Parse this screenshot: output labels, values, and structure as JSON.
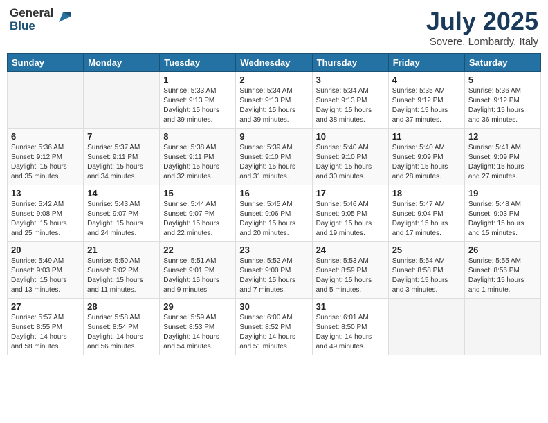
{
  "logo": {
    "general": "General",
    "blue": "Blue"
  },
  "header": {
    "month": "July 2025",
    "location": "Sovere, Lombardy, Italy"
  },
  "weekdays": [
    "Sunday",
    "Monday",
    "Tuesday",
    "Wednesday",
    "Thursday",
    "Friday",
    "Saturday"
  ],
  "weeks": [
    [
      {
        "day": "",
        "info": ""
      },
      {
        "day": "",
        "info": ""
      },
      {
        "day": "1",
        "info": "Sunrise: 5:33 AM\nSunset: 9:13 PM\nDaylight: 15 hours\nand 39 minutes."
      },
      {
        "day": "2",
        "info": "Sunrise: 5:34 AM\nSunset: 9:13 PM\nDaylight: 15 hours\nand 39 minutes."
      },
      {
        "day": "3",
        "info": "Sunrise: 5:34 AM\nSunset: 9:13 PM\nDaylight: 15 hours\nand 38 minutes."
      },
      {
        "day": "4",
        "info": "Sunrise: 5:35 AM\nSunset: 9:12 PM\nDaylight: 15 hours\nand 37 minutes."
      },
      {
        "day": "5",
        "info": "Sunrise: 5:36 AM\nSunset: 9:12 PM\nDaylight: 15 hours\nand 36 minutes."
      }
    ],
    [
      {
        "day": "6",
        "info": "Sunrise: 5:36 AM\nSunset: 9:12 PM\nDaylight: 15 hours\nand 35 minutes."
      },
      {
        "day": "7",
        "info": "Sunrise: 5:37 AM\nSunset: 9:11 PM\nDaylight: 15 hours\nand 34 minutes."
      },
      {
        "day": "8",
        "info": "Sunrise: 5:38 AM\nSunset: 9:11 PM\nDaylight: 15 hours\nand 32 minutes."
      },
      {
        "day": "9",
        "info": "Sunrise: 5:39 AM\nSunset: 9:10 PM\nDaylight: 15 hours\nand 31 minutes."
      },
      {
        "day": "10",
        "info": "Sunrise: 5:40 AM\nSunset: 9:10 PM\nDaylight: 15 hours\nand 30 minutes."
      },
      {
        "day": "11",
        "info": "Sunrise: 5:40 AM\nSunset: 9:09 PM\nDaylight: 15 hours\nand 28 minutes."
      },
      {
        "day": "12",
        "info": "Sunrise: 5:41 AM\nSunset: 9:09 PM\nDaylight: 15 hours\nand 27 minutes."
      }
    ],
    [
      {
        "day": "13",
        "info": "Sunrise: 5:42 AM\nSunset: 9:08 PM\nDaylight: 15 hours\nand 25 minutes."
      },
      {
        "day": "14",
        "info": "Sunrise: 5:43 AM\nSunset: 9:07 PM\nDaylight: 15 hours\nand 24 minutes."
      },
      {
        "day": "15",
        "info": "Sunrise: 5:44 AM\nSunset: 9:07 PM\nDaylight: 15 hours\nand 22 minutes."
      },
      {
        "day": "16",
        "info": "Sunrise: 5:45 AM\nSunset: 9:06 PM\nDaylight: 15 hours\nand 20 minutes."
      },
      {
        "day": "17",
        "info": "Sunrise: 5:46 AM\nSunset: 9:05 PM\nDaylight: 15 hours\nand 19 minutes."
      },
      {
        "day": "18",
        "info": "Sunrise: 5:47 AM\nSunset: 9:04 PM\nDaylight: 15 hours\nand 17 minutes."
      },
      {
        "day": "19",
        "info": "Sunrise: 5:48 AM\nSunset: 9:03 PM\nDaylight: 15 hours\nand 15 minutes."
      }
    ],
    [
      {
        "day": "20",
        "info": "Sunrise: 5:49 AM\nSunset: 9:03 PM\nDaylight: 15 hours\nand 13 minutes."
      },
      {
        "day": "21",
        "info": "Sunrise: 5:50 AM\nSunset: 9:02 PM\nDaylight: 15 hours\nand 11 minutes."
      },
      {
        "day": "22",
        "info": "Sunrise: 5:51 AM\nSunset: 9:01 PM\nDaylight: 15 hours\nand 9 minutes."
      },
      {
        "day": "23",
        "info": "Sunrise: 5:52 AM\nSunset: 9:00 PM\nDaylight: 15 hours\nand 7 minutes."
      },
      {
        "day": "24",
        "info": "Sunrise: 5:53 AM\nSunset: 8:59 PM\nDaylight: 15 hours\nand 5 minutes."
      },
      {
        "day": "25",
        "info": "Sunrise: 5:54 AM\nSunset: 8:58 PM\nDaylight: 15 hours\nand 3 minutes."
      },
      {
        "day": "26",
        "info": "Sunrise: 5:55 AM\nSunset: 8:56 PM\nDaylight: 15 hours\nand 1 minute."
      }
    ],
    [
      {
        "day": "27",
        "info": "Sunrise: 5:57 AM\nSunset: 8:55 PM\nDaylight: 14 hours\nand 58 minutes."
      },
      {
        "day": "28",
        "info": "Sunrise: 5:58 AM\nSunset: 8:54 PM\nDaylight: 14 hours\nand 56 minutes."
      },
      {
        "day": "29",
        "info": "Sunrise: 5:59 AM\nSunset: 8:53 PM\nDaylight: 14 hours\nand 54 minutes."
      },
      {
        "day": "30",
        "info": "Sunrise: 6:00 AM\nSunset: 8:52 PM\nDaylight: 14 hours\nand 51 minutes."
      },
      {
        "day": "31",
        "info": "Sunrise: 6:01 AM\nSunset: 8:50 PM\nDaylight: 14 hours\nand 49 minutes."
      },
      {
        "day": "",
        "info": ""
      },
      {
        "day": "",
        "info": ""
      }
    ]
  ]
}
